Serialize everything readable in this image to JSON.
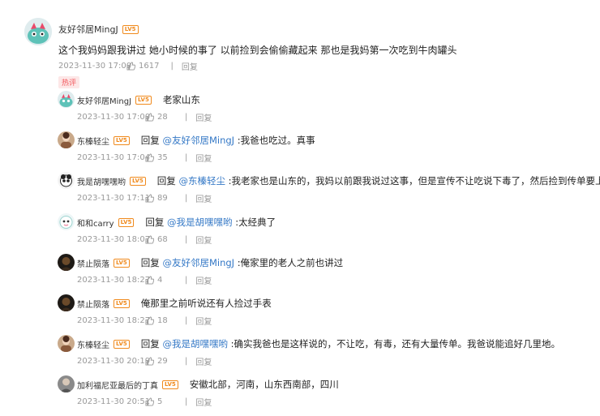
{
  "main_comment": {
    "user": "友好邻居MingJ",
    "level": "LV5",
    "text": "这个我妈妈跟我讲过 她小时候的事了 以前捡到会偷偷藏起来 那也是我妈第一次吃到牛肉罐头",
    "time": "2023-11-30 17:00",
    "likes": "1617",
    "reply_label": "回复",
    "badge": "热评"
  },
  "replies": [
    {
      "user": "友好邻居MingJ",
      "level": "LV5",
      "reply_prefix": "",
      "mention": "",
      "text": "老家山东",
      "time": "2023-11-30 17:00",
      "likes": "28",
      "reply_label": "回复"
    },
    {
      "user": "东榛轻尘",
      "level": "LV5",
      "reply_prefix": "回复",
      "mention": "@友好邻居MingJ",
      "text": ":我爸也吃过。真事",
      "time": "2023-11-30 17:04",
      "likes": "35",
      "reply_label": "回复"
    },
    {
      "user": "我是胡嘿嘿哟",
      "level": "LV5",
      "reply_prefix": "回复",
      "mention": "@东榛轻尘",
      "text": ":我老家也是山东的，我妈以前跟我说过这事，但是宣传不让吃说下毒了，然后捡到传单要上交",
      "time": "2023-11-30 17:11",
      "likes": "89",
      "reply_label": "回复"
    },
    {
      "user": "和和carry",
      "level": "LV5",
      "reply_prefix": "回复",
      "mention": "@我是胡嘿嘿哟",
      "text": ":太经典了",
      "time": "2023-11-30 18:07",
      "likes": "68",
      "reply_label": "回复"
    },
    {
      "user": "禁止陨落",
      "level": "LV5",
      "reply_prefix": "回复",
      "mention": "@友好邻居MingJ",
      "text": ":俺家里的老人之前也讲过",
      "time": "2023-11-30 18:27",
      "likes": "4",
      "reply_label": "回复"
    },
    {
      "user": "禁止陨落",
      "level": "LV5",
      "reply_prefix": "",
      "mention": "",
      "text": "俺那里之前听说还有人捡过手表",
      "time": "2023-11-30 18:27",
      "likes": "18",
      "reply_label": "回复"
    },
    {
      "user": "东榛轻尘",
      "level": "LV5",
      "reply_prefix": "回复",
      "mention": "@我是胡嘿嘿哟",
      "text": ":确实我爸也是这样说的，不让吃，有毒，还有大量传单。我爸说能追好几里地。",
      "time": "2023-11-30 20:19",
      "likes": "29",
      "reply_label": "回复"
    },
    {
      "user": "加利福尼亚最后的丁真",
      "level": "LV5",
      "reply_prefix": "",
      "mention": "",
      "text": "安徽北部，河南，山东西南部，四川",
      "time": "2023-11-30 20:51",
      "likes": "5",
      "reply_label": "回复"
    }
  ],
  "colors": {
    "mention": "#3478c6",
    "level_badge": "#f08a1d",
    "hot_badge": "#f2575c",
    "meta": "#999999"
  }
}
